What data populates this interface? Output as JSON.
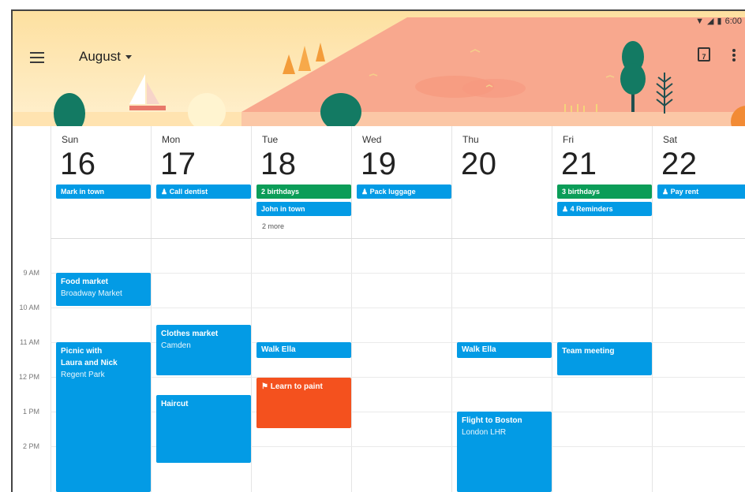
{
  "status": {
    "time": "6:00"
  },
  "header": {
    "month": "August",
    "today_number": "7"
  },
  "colors": {
    "blue": "#039be5",
    "green": "#0b9d58",
    "orange": "#f4511e",
    "header_bg": "#fde3a7",
    "hill": "#f8a88e"
  },
  "days": [
    {
      "name": "Sun",
      "number": "16"
    },
    {
      "name": "Mon",
      "number": "17"
    },
    {
      "name": "Tue",
      "number": "18"
    },
    {
      "name": "Wed",
      "number": "19"
    },
    {
      "name": "Thu",
      "number": "20"
    },
    {
      "name": "Fri",
      "number": "21"
    },
    {
      "name": "Sat",
      "number": "22"
    }
  ],
  "all_day": {
    "sun": "Mark in town",
    "mon": "Call dentist",
    "tue_1": "2 birthdays",
    "tue_2": "John in town",
    "tue_more": "2 more",
    "wed": "Pack luggage",
    "fri_1": "3 birthdays",
    "fri_2": "4 Reminders",
    "sat": "Pay rent"
  },
  "times": [
    "9 AM",
    "10 AM",
    "11 AM",
    "12 PM",
    "1 PM",
    "2 PM"
  ],
  "events": {
    "food_market": {
      "title": "Food market",
      "location": "Broadway Market"
    },
    "picnic": {
      "title": "Picnic with Laura and Nick",
      "location": "Regent Park"
    },
    "clothes_market": {
      "title": "Clothes market",
      "location": "Camden"
    },
    "haircut": {
      "title": "Haircut"
    },
    "walk_ella_tue": {
      "title": "Walk Ella"
    },
    "learn_paint": {
      "title": "Learn to paint"
    },
    "walk_ella_thu": {
      "title": "Walk Ella"
    },
    "flight": {
      "title": "Flight to Boston",
      "location": "London LHR"
    },
    "team_meeting": {
      "title": "Team meeting"
    }
  }
}
